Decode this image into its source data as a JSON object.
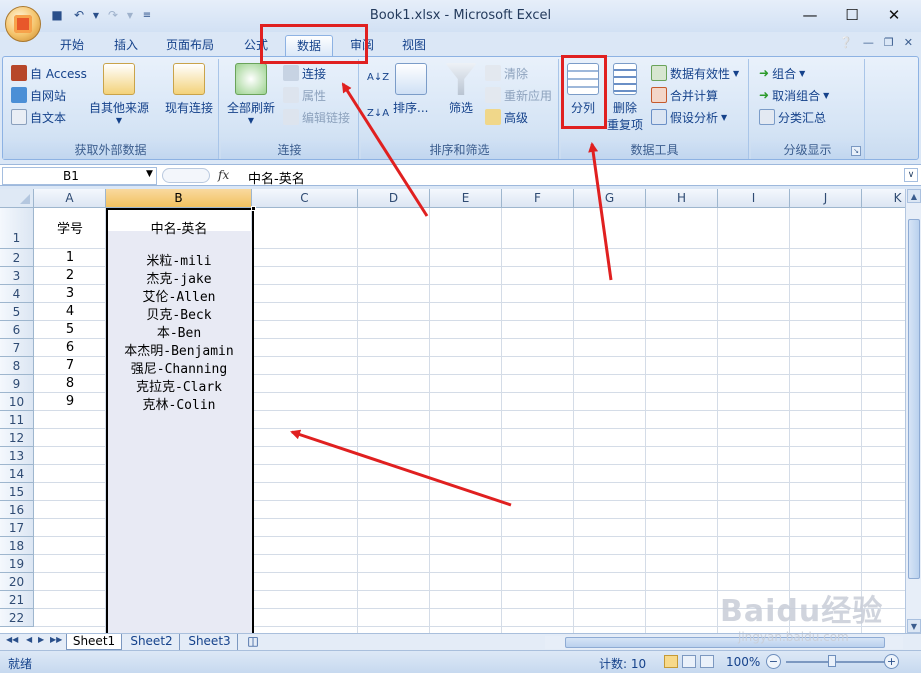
{
  "window": {
    "title": "Book1.xlsx - Microsoft Excel"
  },
  "ribbon": {
    "tabs": [
      "开始",
      "插入",
      "页面布局",
      "公式",
      "数据",
      "审阅",
      "视图"
    ],
    "active_tab": "数据",
    "groups": {
      "external": {
        "label": "获取外部数据",
        "access": "自 Access",
        "web": "自网站",
        "text": "自文本",
        "other": "自其他来源",
        "existing": "现有连接"
      },
      "connections": {
        "label": "连接",
        "refresh_all": "全部刷新",
        "connections": "连接",
        "properties": "属性",
        "edit_links": "编辑链接"
      },
      "sort_filter": {
        "label": "排序和筛选",
        "sort": "排序...",
        "filter": "筛选",
        "clear": "清除",
        "reapply": "重新应用",
        "advanced": "高级"
      },
      "data_tools": {
        "label": "数据工具",
        "text_to_columns": "分列",
        "remove_dup_1": "删除",
        "remove_dup_2": "重复项",
        "validation": "数据有效性",
        "consolidate": "合并计算",
        "whatif": "假设分析"
      },
      "outline": {
        "label": "分级显示",
        "group": "组合",
        "ungroup": "取消组合",
        "subtotal": "分类汇总"
      }
    }
  },
  "formula_bar": {
    "name_box": "B1",
    "fx": "fx",
    "value": "中名-英名"
  },
  "sheet": {
    "columns": [
      "A",
      "B",
      "C",
      "D",
      "E",
      "F",
      "G",
      "H",
      "I",
      "J",
      "K"
    ],
    "rows": [
      "1",
      "2",
      "3",
      "4",
      "5",
      "6",
      "7",
      "8",
      "9",
      "10",
      "11",
      "12",
      "13",
      "14",
      "15",
      "16",
      "17",
      "18",
      "19",
      "20",
      "21",
      "22"
    ],
    "header_a": "学号",
    "header_b": "中名-英名",
    "ids": [
      "1",
      "2",
      "3",
      "4",
      "5",
      "6",
      "7",
      "8",
      "9"
    ],
    "names": [
      "米粒-mili",
      "杰克-jake",
      "艾伦-Allen",
      "贝克-Beck",
      "本-Ben",
      "本杰明-Benjamin",
      "强尼-Channing",
      "克拉克-Clark",
      "克林-Colin"
    ]
  },
  "sheet_tabs": [
    "Sheet1",
    "Sheet2",
    "Sheet3"
  ],
  "status": {
    "ready": "就绪",
    "count": "计数: 10",
    "zoom": "100%"
  },
  "watermark": {
    "brand": "Baidu经验",
    "url": "jingyan.baidu.com"
  },
  "colors": {
    "annotation": "#e02020",
    "selection_header": "#f1c15f",
    "ribbon_bg": "#d5e4f5"
  }
}
